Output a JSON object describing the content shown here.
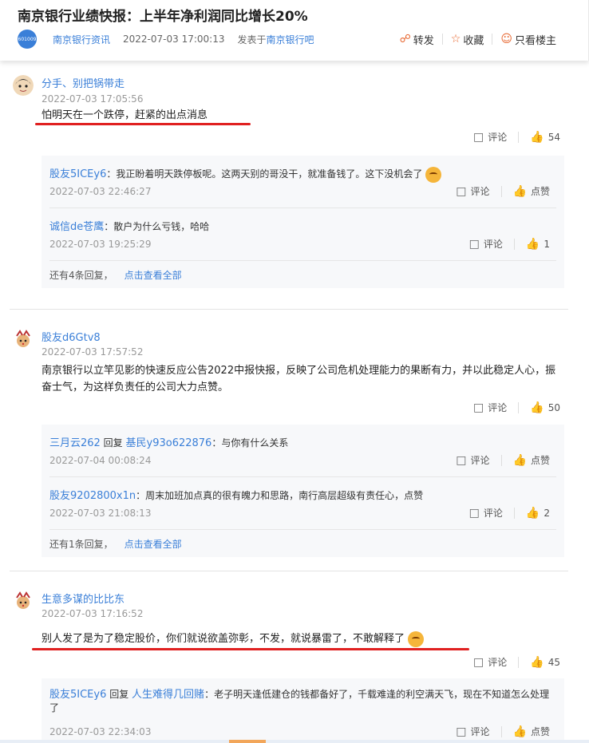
{
  "header": {
    "title": "南京银行业绩快报：上半年净利润同比增长20%",
    "stock_code": "601009",
    "author": "南京银行资讯",
    "datetime": "2022-07-03 17:00:13",
    "posted_in_label": "发表于",
    "forum": "南京银行吧",
    "actions": {
      "share": "转发",
      "favorite": "收藏",
      "author_only": "只看楼主"
    }
  },
  "labels": {
    "comment": "评论",
    "like": "点赞",
    "view_all": "点击查看全部",
    "reply_word": "回复"
  },
  "posts": [
    {
      "user": "分手、别把锅带走",
      "time": "2022-07-03 17:05:56",
      "text": "怕明天在一个跌停，赶紧的出点消息",
      "likes": "54",
      "replies": [
        {
          "user": "股友5ICEy6",
          "sep": "：",
          "text": "我正盼着明天跌停板呢。这两天别的哥没干，就准备钱了。这下没机会了",
          "time": "2022-07-03 22:46:27",
          "likes": "点赞"
        },
        {
          "user": "诚信de苍鹰",
          "sep": "：",
          "text": "散户为什么亏钱，哈哈",
          "time": "2022-07-03 19:25:29",
          "likes": "1"
        }
      ],
      "more": "还有4条回复，"
    },
    {
      "user": "股友d6Gtv8",
      "time": "2022-07-03 17:57:52",
      "text": "南京银行以立竿见影的快速反应公告2022中报快报，反映了公司危机处理能力的果断有力，并以此稳定人心，振奋士气，为这样负责任的公司大力点赞。",
      "likes": "50",
      "replies": [
        {
          "user": "三月云262",
          "reply_to": "基民y93o622876",
          "sep": "：",
          "text": "与你有什么关系",
          "time": "2022-07-04 00:08:24",
          "likes": "点赞"
        },
        {
          "user": "股友9202800x1n",
          "sep": "：",
          "text": "周末加班加点真的很有魄力和思路，南行高层超级有责任心，点赞",
          "time": "2022-07-03 21:08:13",
          "likes": "2"
        }
      ],
      "more": "还有1条回复，"
    },
    {
      "user": "生意多谋的比比东",
      "time": "2022-07-03 17:16:52",
      "text": "别人发了是为了稳定股价，你们就说欲盖弥彰，不发，就说暴雷了，不敢解释了",
      "likes": "45",
      "replies": [
        {
          "user": "股友5ICEy6",
          "reply_to": "人生难得几回赌",
          "sep": "：",
          "text": "老子明天逢低建仓的钱都备好了，千载难逢的利空满天飞，现在不知道怎么处理了",
          "time": "2022-07-03 22:34:03",
          "likes": "点赞"
        }
      ]
    }
  ],
  "colors": {
    "link": "#3a7fd8",
    "accent": "#e7652d",
    "underline": "#e02020"
  }
}
